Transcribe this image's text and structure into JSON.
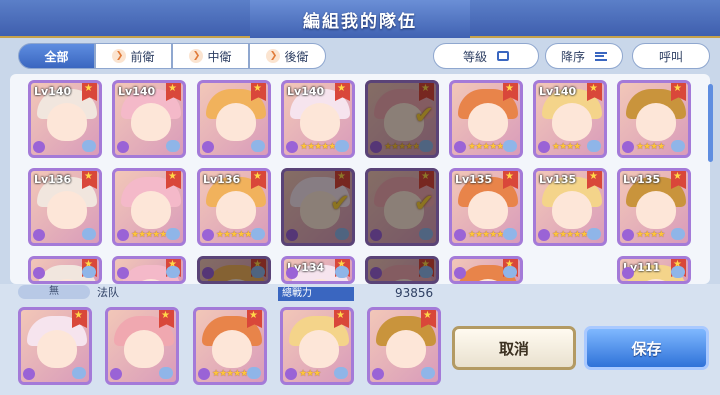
{
  "title": "編組我的隊伍",
  "tabs": [
    {
      "label": "全部",
      "active": true
    },
    {
      "label": "前衛",
      "active": false
    },
    {
      "label": "中衛",
      "active": false
    },
    {
      "label": "後衛",
      "active": false
    }
  ],
  "sort": {
    "level_label": "等級",
    "order_label": "降序",
    "call_label": "呼叫"
  },
  "grid": {
    "row1": [
      {
        "level": "Lv140",
        "checked": false,
        "stars": ""
      },
      {
        "level": "Lv140",
        "checked": false,
        "stars": ""
      },
      {
        "level": "",
        "checked": false,
        "stars": ""
      },
      {
        "level": "Lv140",
        "checked": false,
        "stars": "★★★★★"
      },
      {
        "level": "",
        "checked": true,
        "stars": "★★★★★"
      },
      {
        "level": "",
        "checked": false,
        "stars": "★★★★★"
      },
      {
        "level": "Lv140",
        "checked": false,
        "stars": "★★★★"
      },
      {
        "level": "",
        "checked": false,
        "stars": "★★★★"
      }
    ],
    "row2": [
      {
        "level": "Lv136",
        "checked": false,
        "stars": ""
      },
      {
        "level": "",
        "checked": false,
        "stars": "★★★★★"
      },
      {
        "level": "Lv136",
        "checked": false,
        "stars": "★★★★★"
      },
      {
        "level": "",
        "checked": true,
        "stars": ""
      },
      {
        "level": "",
        "checked": true,
        "stars": ""
      },
      {
        "level": "Lv135",
        "checked": false,
        "stars": "★★★★★"
      },
      {
        "level": "Lv135",
        "checked": false,
        "stars": "★★★★★"
      },
      {
        "level": "Lv135",
        "checked": false,
        "stars": "★★★★"
      }
    ],
    "row3": [
      {
        "level": "",
        "checked": false,
        "stars": ""
      },
      {
        "level": "",
        "checked": false,
        "stars": ""
      },
      {
        "level": "",
        "checked": true,
        "stars": ""
      },
      {
        "level": "Lv134",
        "checked": false,
        "stars": ""
      },
      {
        "level": "",
        "checked": true,
        "stars": ""
      },
      {
        "level": "",
        "checked": false,
        "stars": ""
      },
      {
        "level": "Lv111",
        "checked": false,
        "stars": ""
      }
    ]
  },
  "team": {
    "tag": "無",
    "name": "法队",
    "power_label": "總戰力",
    "power_value": "93856",
    "members": [
      {
        "stars": ""
      },
      {
        "stars": ""
      },
      {
        "stars": "★★★★★"
      },
      {
        "stars": "★★★"
      },
      {
        "stars": ""
      }
    ]
  },
  "buttons": {
    "cancel": "取消",
    "save": "保存"
  },
  "colors": {
    "accent": "#3a66c0",
    "frame": "#a47ad8",
    "check": "#ffd23a"
  }
}
